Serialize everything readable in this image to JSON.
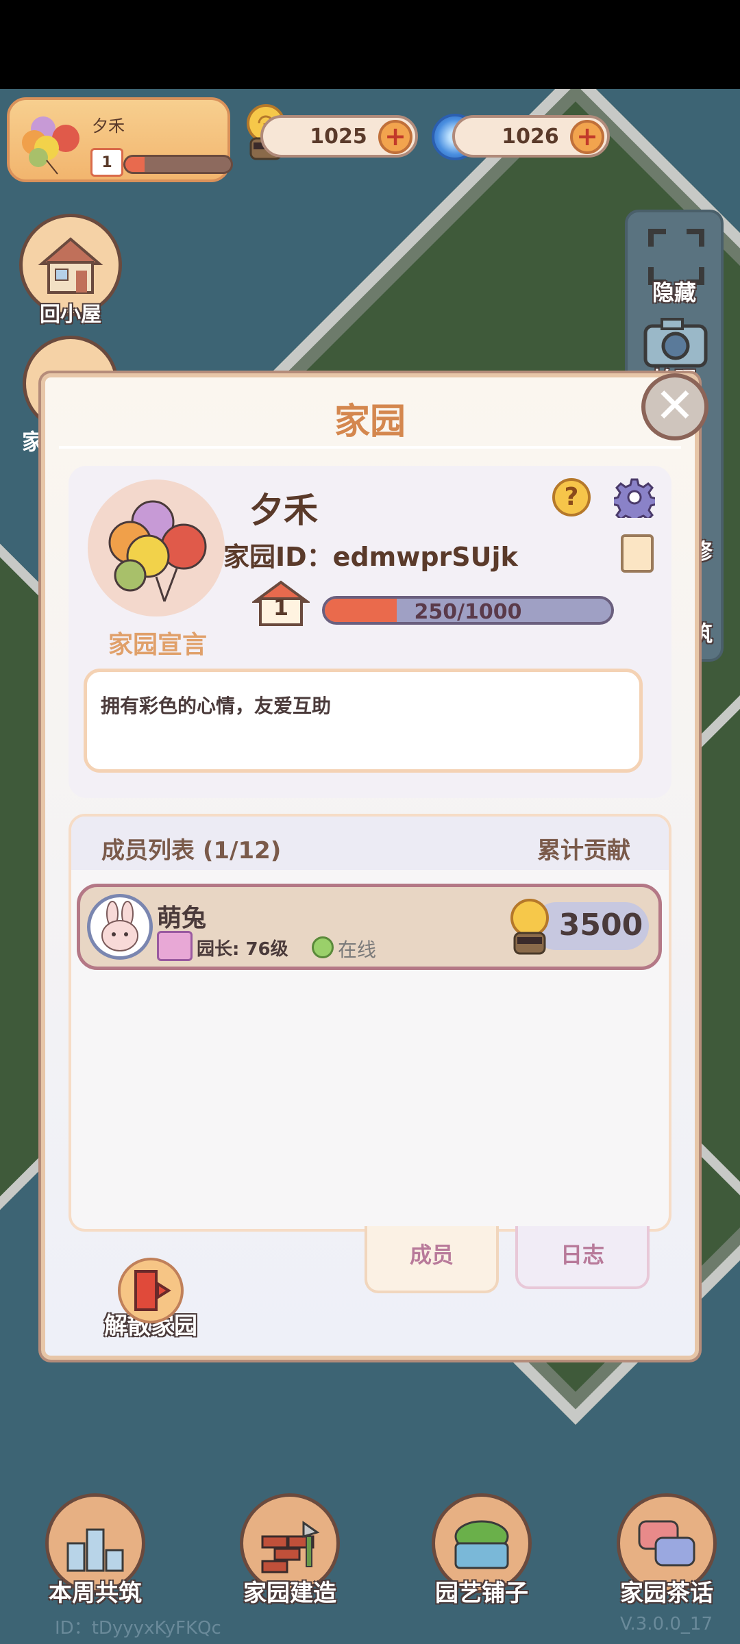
{
  "hud": {
    "profile_name": "夕禾",
    "profile_level": "1",
    "profile_level_progress": 0.18,
    "snail_currency": "1025",
    "swirl_currency": "1026",
    "plus": "+"
  },
  "left_side": {
    "back_home": "回小屋",
    "home_partial": "家"
  },
  "right_side": {
    "hide": "隐藏",
    "photo": "拍照",
    "repair_partial": "修",
    "build_partial": "筑"
  },
  "modal": {
    "title": "家园",
    "close": "✕",
    "home_name": "夕禾",
    "home_id": "家园ID：edmwprSUjk",
    "level": "1",
    "exp_text": "250/1000",
    "exp_progress": 0.25,
    "manifesto_label": "家园宣言",
    "manifesto_text": "拥有彩色的心情，友爱互助",
    "help": "?"
  },
  "members": {
    "header_left": "成员列表 (1/12)",
    "header_right": "累计贡献",
    "rows": [
      {
        "name": "萌兔",
        "role": "园长: 76级",
        "status": "在线",
        "contribution": "3500"
      }
    ]
  },
  "tabs": {
    "members": "成员",
    "log": "日志"
  },
  "disband": "解散家园",
  "bottom_bar": {
    "weekly": "本周共筑",
    "build": "家园建造",
    "garden_shop": "园艺铺子",
    "chat": "家园茶话"
  },
  "footer": {
    "id": "ID：tDyyyxKyFKQc",
    "version": "V.3.0.0_17"
  }
}
